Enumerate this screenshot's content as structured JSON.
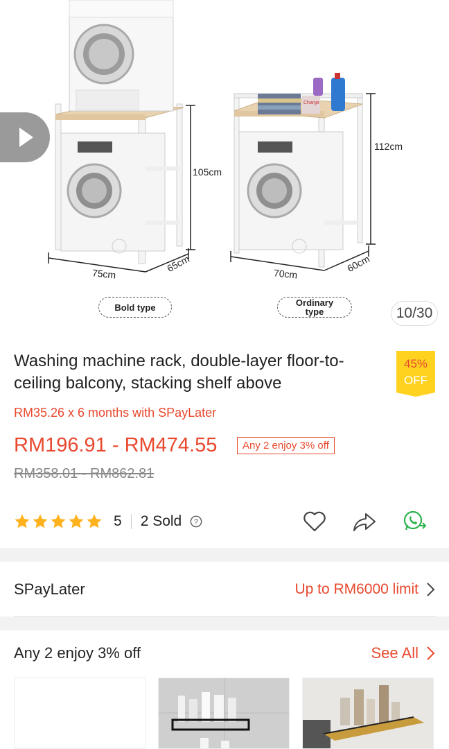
{
  "hero": {
    "counter": "10/30",
    "dims": [
      "105cm",
      "75cm",
      "65cm",
      "112cm",
      "70cm",
      "60cm"
    ],
    "types": [
      "Bold type",
      "Ordinary type"
    ],
    "box_label": "Charge"
  },
  "product": {
    "title": "Washing machine rack, double-layer floor-to-ceiling balcony, stacking shelf above",
    "discount_pct": "45%",
    "discount_off": "OFF",
    "installment": "RM35.26 x 6 months with SPayLater",
    "price": "RM196.91 - RM474.55",
    "promo_tag": "Any 2 enjoy 3% off",
    "original_price": "RM358.01 - RM862.81",
    "rating": "5",
    "rating_stars": 5,
    "sold": "2 Sold"
  },
  "spaylater": {
    "label": "SPayLater",
    "limit": "Up to RM6000 limit"
  },
  "bundle": {
    "label": "Any 2 enjoy 3% off",
    "see_all": "See All"
  },
  "colors": {
    "accent": "#e8492e",
    "star": "#ffb21d",
    "whatsapp": "#2bb24c",
    "discount_bg": "#ffd21f"
  },
  "icons": [
    "play-icon",
    "star-icon",
    "help-icon",
    "heart-icon",
    "share-icon",
    "whatsapp-icon",
    "chevron-right-icon"
  ]
}
